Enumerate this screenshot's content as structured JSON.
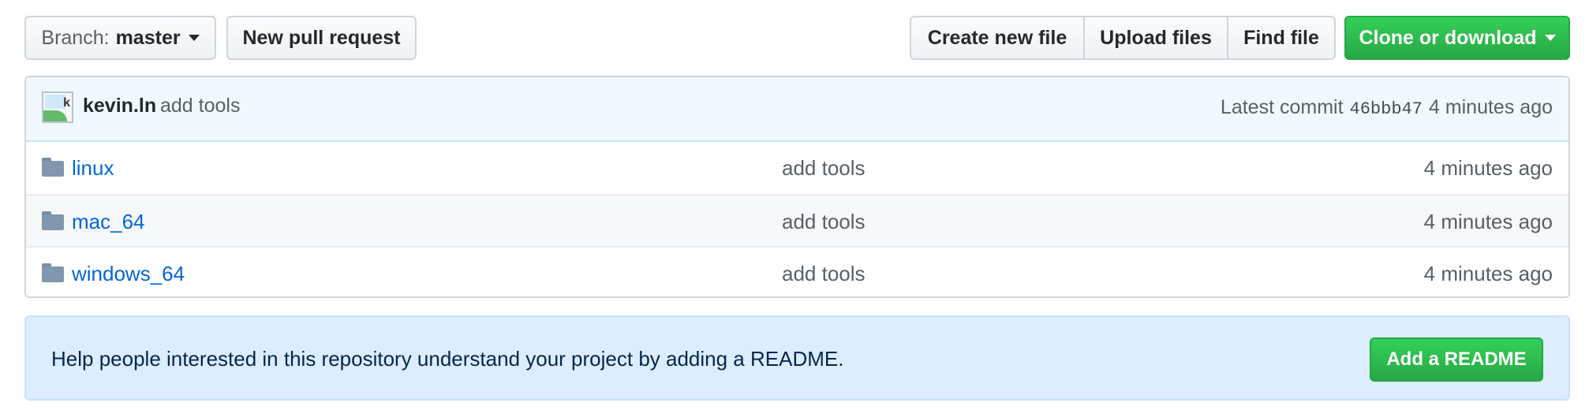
{
  "toolbar": {
    "branch_prefix": "Branch:",
    "branch_name": "master",
    "new_pull_request": "New pull request",
    "create_new_file": "Create new file",
    "upload_files": "Upload files",
    "find_file": "Find file",
    "clone_or_download": "Clone or download"
  },
  "commit": {
    "author": "kevin.ln",
    "message": "add tools",
    "latest_label": "Latest commit",
    "sha": "46bbb47",
    "time": "4 minutes ago"
  },
  "files": [
    {
      "name": "linux",
      "message": "add tools",
      "age": "4 minutes ago"
    },
    {
      "name": "mac_64",
      "message": "add tools",
      "age": "4 minutes ago"
    },
    {
      "name": "windows_64",
      "message": "add tools",
      "age": "4 minutes ago"
    }
  ],
  "readme": {
    "prompt": "Help people interested in this repository understand your project by adding a README.",
    "button": "Add a README"
  },
  "colors": {
    "link": "#0366d6",
    "primary_green": "#28a745",
    "commit_bar_bg": "#f1f8ff",
    "readme_bg": "#dbedff"
  }
}
